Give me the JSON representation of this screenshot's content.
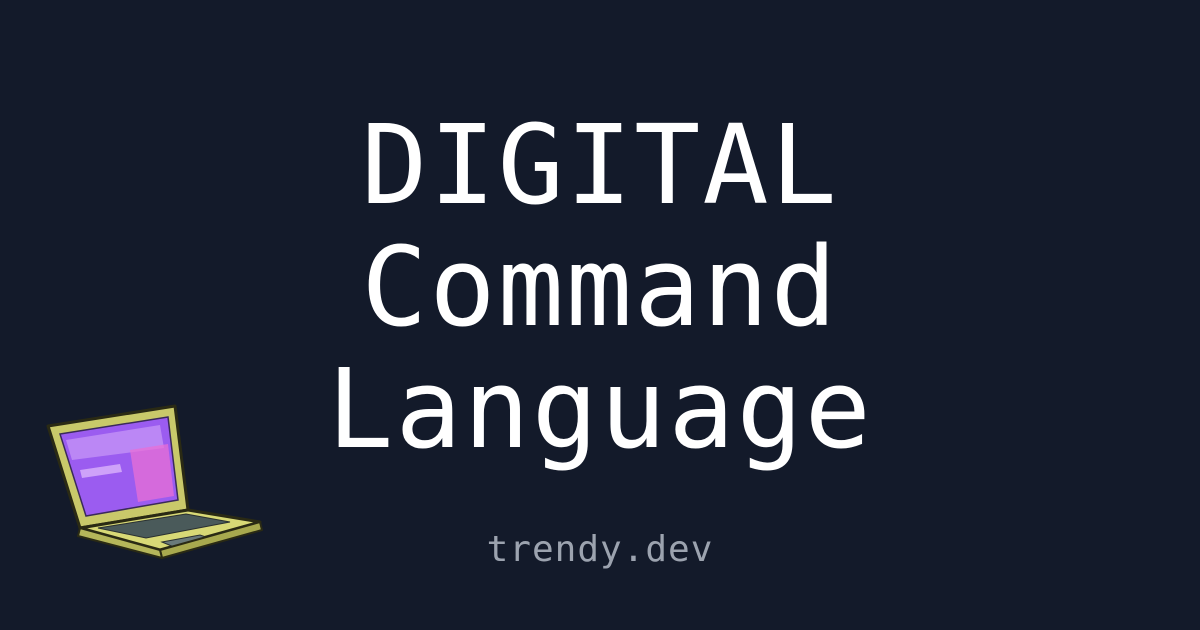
{
  "title": {
    "line1": "DIGITAL",
    "line2": "Command",
    "line3": "Language"
  },
  "site": {
    "name": "trendy.dev"
  },
  "illustration": {
    "icon": "laptop-icon"
  },
  "colors": {
    "background": "#131a2a",
    "title": "#ffffff",
    "site": "#9ca3af",
    "laptop_body": "#d8d976",
    "laptop_screen": "#a35cf0"
  }
}
